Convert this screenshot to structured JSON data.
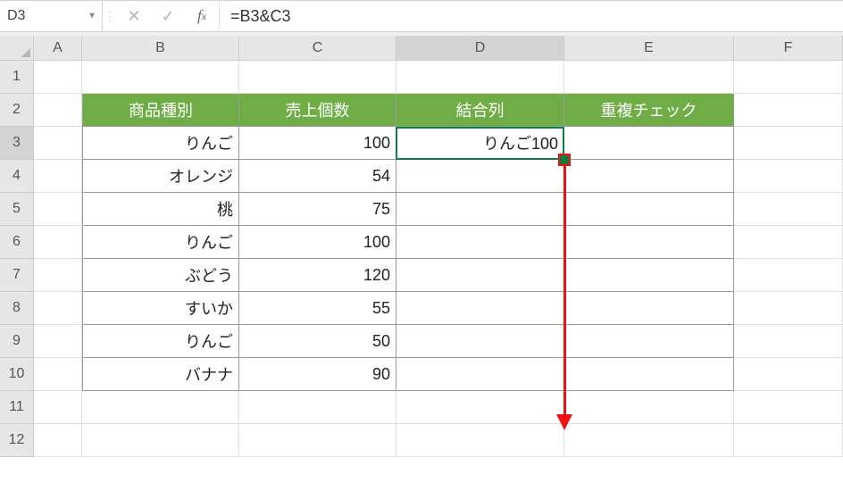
{
  "formula_bar": {
    "name_box": "D3",
    "formula": "=B3&C3"
  },
  "columns": [
    "A",
    "B",
    "C",
    "D",
    "E",
    "F"
  ],
  "active_column": "D",
  "active_row": 3,
  "row_numbers": [
    1,
    2,
    3,
    4,
    5,
    6,
    7,
    8,
    9,
    10,
    11,
    12
  ],
  "table": {
    "headers": {
      "B": "商品種別",
      "C": "売上個数",
      "D": "結合列",
      "E": "重複チェック"
    },
    "rows": [
      {
        "B": "りんご",
        "C": 100,
        "D": "りんご100",
        "E": ""
      },
      {
        "B": "オレンジ",
        "C": 54,
        "D": "",
        "E": ""
      },
      {
        "B": "桃",
        "C": 75,
        "D": "",
        "E": ""
      },
      {
        "B": "りんご",
        "C": 100,
        "D": "",
        "E": ""
      },
      {
        "B": "ぶどう",
        "C": 120,
        "D": "",
        "E": ""
      },
      {
        "B": "すいか",
        "C": 55,
        "D": "",
        "E": ""
      },
      {
        "B": "りんご",
        "C": 50,
        "D": "",
        "E": ""
      },
      {
        "B": "バナナ",
        "C": 90,
        "D": "",
        "E": ""
      }
    ]
  },
  "chart_data": {
    "type": "table",
    "title": "",
    "columns": [
      "商品種別",
      "売上個数",
      "結合列",
      "重複チェック"
    ],
    "rows": [
      [
        "りんご",
        100,
        "りんご100",
        ""
      ],
      [
        "オレンジ",
        54,
        "",
        ""
      ],
      [
        "桃",
        75,
        "",
        ""
      ],
      [
        "りんご",
        100,
        "",
        ""
      ],
      [
        "ぶどう",
        120,
        "",
        ""
      ],
      [
        "すいか",
        55,
        "",
        ""
      ],
      [
        "りんご",
        50,
        "",
        ""
      ],
      [
        "バナナ",
        90,
        "",
        ""
      ]
    ]
  }
}
